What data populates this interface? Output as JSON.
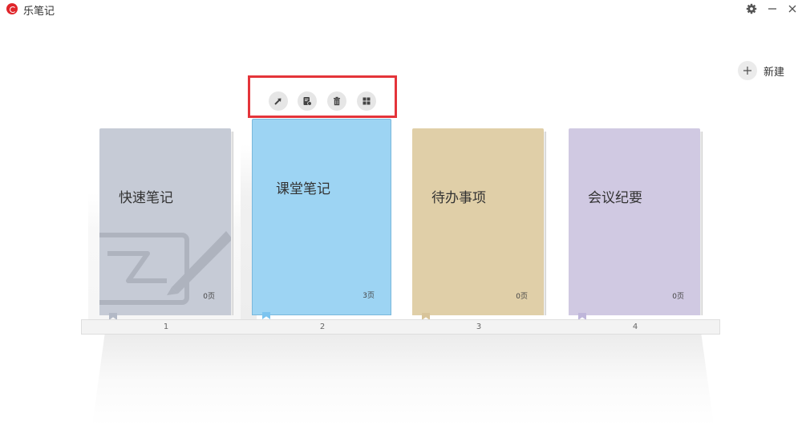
{
  "app": {
    "title": "乐笔记"
  },
  "window": {
    "settings_icon": "gear-icon",
    "minimize_icon": "minimize-icon",
    "close_icon": "close-icon"
  },
  "header": {
    "new_label": "新建",
    "new_icon": "plus-icon"
  },
  "toolbar": {
    "highlight_color": "#e4343a",
    "buttons": [
      {
        "icon": "share-arrow-icon"
      },
      {
        "icon": "edit-notebook-icon"
      },
      {
        "icon": "trash-icon"
      },
      {
        "icon": "grid-icon"
      }
    ]
  },
  "notebooks": [
    {
      "title": "快速笔记",
      "pages": "0页",
      "shelf_number": "1",
      "color": "#c6cbd6",
      "bookmark_color": "#b3b9c6"
    },
    {
      "title": "课堂笔记",
      "pages": "3页",
      "shelf_number": "2",
      "color": "#9dd4f3",
      "bookmark_color": "#7cc4ef",
      "selected": true
    },
    {
      "title": "待办事项",
      "pages": "0页",
      "shelf_number": "3",
      "color": "#e0cfa8",
      "bookmark_color": "#d8c49a"
    },
    {
      "title": "会议纪要",
      "pages": "0页",
      "shelf_number": "4",
      "color": "#d0c9e2",
      "bookmark_color": "#bfb6da"
    }
  ]
}
